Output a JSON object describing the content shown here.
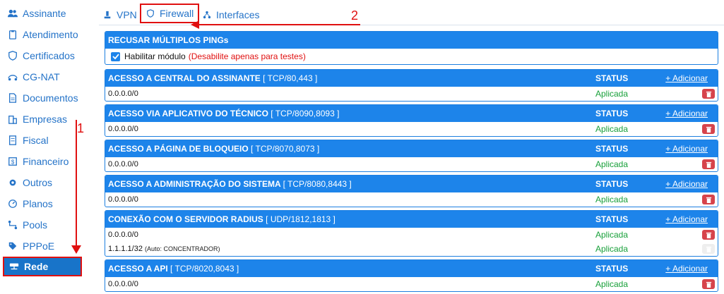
{
  "sidebar": {
    "items": [
      {
        "label": "Assinante",
        "icon": "users-icon"
      },
      {
        "label": "Atendimento",
        "icon": "clipboard-icon"
      },
      {
        "label": "Certificados",
        "icon": "shield-icon"
      },
      {
        "label": "CG-NAT",
        "icon": "network-icon"
      },
      {
        "label": "Documentos",
        "icon": "document-icon"
      },
      {
        "label": "Empresas",
        "icon": "building-icon"
      },
      {
        "label": "Fiscal",
        "icon": "invoice-icon"
      },
      {
        "label": "Financeiro",
        "icon": "money-icon"
      },
      {
        "label": "Outros",
        "icon": "gear-icon"
      },
      {
        "label": "Planos",
        "icon": "gauge-icon"
      },
      {
        "label": "Pools",
        "icon": "route-icon"
      },
      {
        "label": "PPPoE",
        "icon": "tag-icon"
      },
      {
        "label": "Rede",
        "icon": "server-icon",
        "active": true
      }
    ]
  },
  "tabs": [
    {
      "label": "VPN",
      "icon": "vpn-icon"
    },
    {
      "label": "Firewall",
      "icon": "shield-icon",
      "active": true
    },
    {
      "label": "Interfaces",
      "icon": "interfaces-icon"
    }
  ],
  "annotations": {
    "num1": "1",
    "num2": "2",
    "color": "#e01010"
  },
  "ping_block": {
    "title": "RECUSAR MÚLTIPLOS PINGs",
    "checkbox_label": "Habilitar módulo",
    "warning": "(Desabilite apenas para testes)",
    "checked": true
  },
  "status_label": "STATUS",
  "add_label": "+ Adicionar",
  "applied_label": "Aplicada",
  "rules": [
    {
      "title": "ACESSO A CENTRAL DO ASSINANTE",
      "ports": "[ TCP/80,443 ]",
      "rows": [
        {
          "ip": "0.0.0.0/0",
          "note": ""
        }
      ]
    },
    {
      "title": "ACESSO VIA APLICATIVO DO TÉCNICO",
      "ports": "[ TCP/8090,8093 ]",
      "rows": [
        {
          "ip": "0.0.0.0/0",
          "note": ""
        }
      ]
    },
    {
      "title": "ACESSO A PÁGINA DE BLOQUEIO",
      "ports": "[ TCP/8070,8073 ]",
      "rows": [
        {
          "ip": "0.0.0.0/0",
          "note": ""
        }
      ]
    },
    {
      "title": "ACESSO A ADMINISTRAÇÃO DO SISTEMA",
      "ports": "[ TCP/8080,8443 ]",
      "rows": [
        {
          "ip": "0.0.0.0/0",
          "note": ""
        }
      ]
    },
    {
      "title": "CONEXÃO COM O SERVIDOR RADIUS",
      "ports": "[ UDP/1812,1813 ]",
      "rows": [
        {
          "ip": "0.0.0.0/0",
          "note": ""
        },
        {
          "ip": "1.1.1.1/32",
          "note": "(Auto: CONCENTRADOR)",
          "disabled": true
        }
      ]
    },
    {
      "title": "ACESSO A API",
      "ports": "[ TCP/8020,8043 ]",
      "rows": [
        {
          "ip": "0.0.0.0/0",
          "note": ""
        }
      ]
    }
  ],
  "colors": {
    "accent": "#1d84ea",
    "link": "#2473c8",
    "applied": "#18a03a",
    "delete": "#d6434b"
  }
}
